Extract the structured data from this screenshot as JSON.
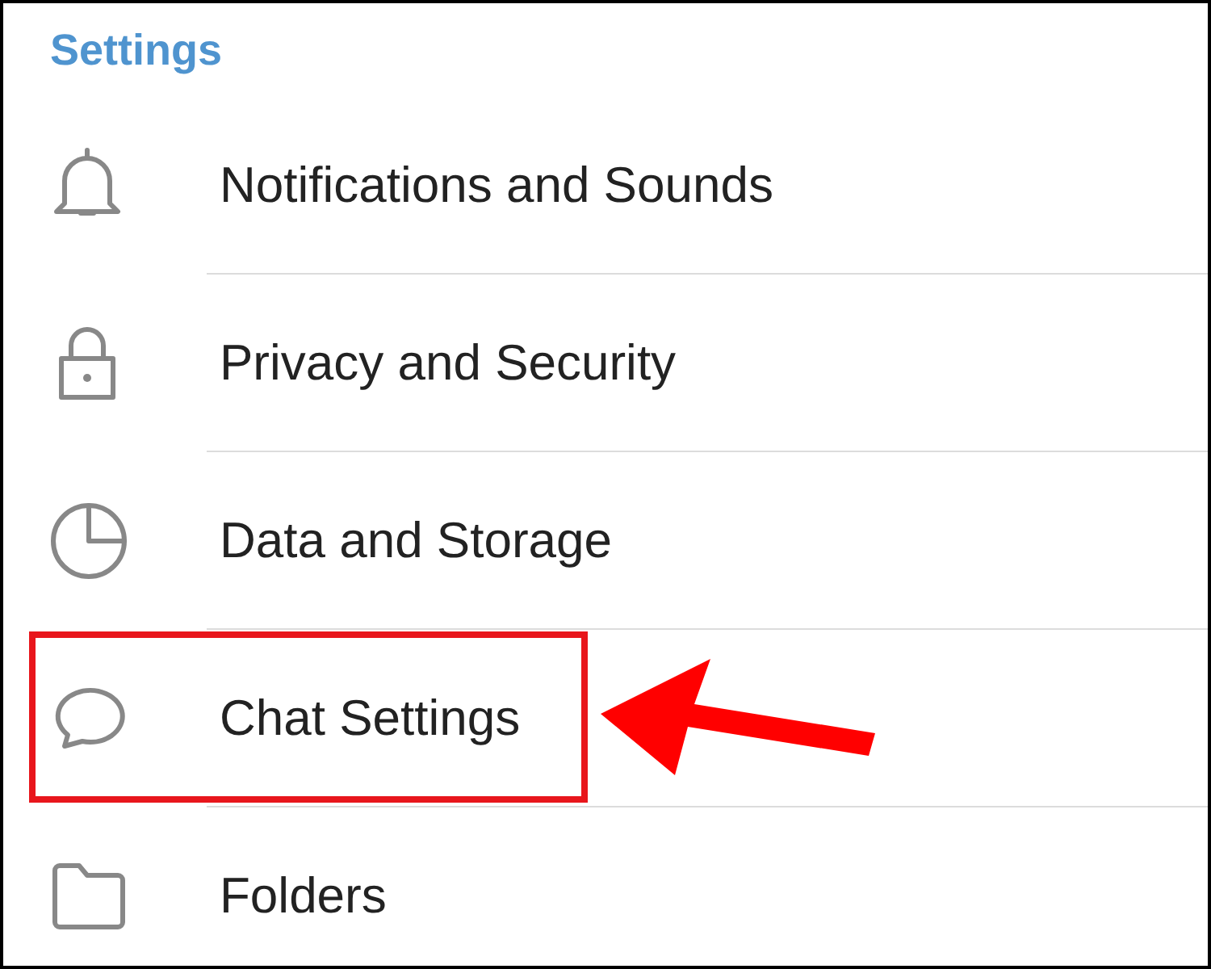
{
  "header": {
    "title": "Settings"
  },
  "items": [
    {
      "label": "Notifications and Sounds",
      "kind": "bell",
      "highlighted": false
    },
    {
      "label": "Privacy and Security",
      "kind": "lock",
      "highlighted": false
    },
    {
      "label": "Data and Storage",
      "kind": "pie",
      "highlighted": false
    },
    {
      "label": "Chat Settings",
      "kind": "chat",
      "highlighted": true
    },
    {
      "label": "Folders",
      "kind": "folder",
      "highlighted": false
    }
  ]
}
